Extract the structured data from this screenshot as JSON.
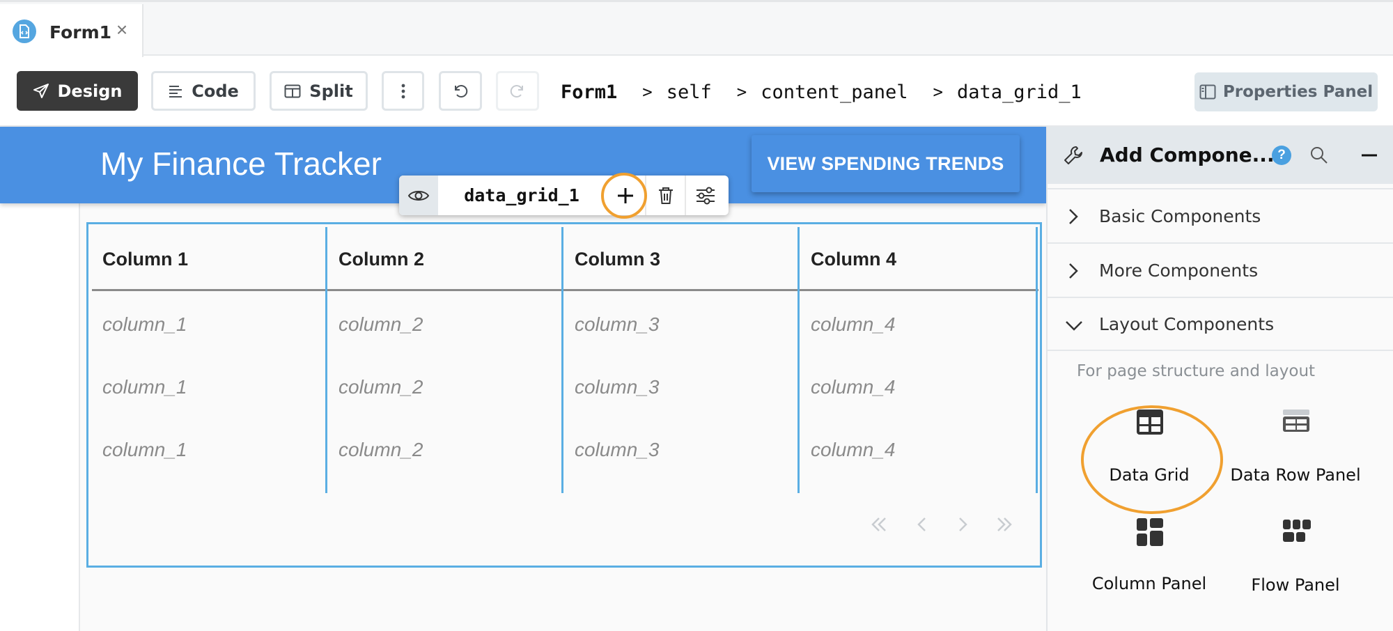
{
  "tab": {
    "label": "Form1",
    "icon": "form-file-icon",
    "close": "×"
  },
  "toolbar": {
    "design_label": "Design",
    "code_label": "Code",
    "split_label": "Split",
    "breadcrumb": [
      "Form1",
      "self",
      "content_panel",
      "data_grid_1"
    ],
    "breadcrumb_sep": ">",
    "properties_label": "Properties Panel"
  },
  "canvas": {
    "app_title": "My Finance Tracker",
    "trends_button": "VIEW SPENDING TRENDS",
    "component_toolbar": {
      "name": "data_grid_1"
    },
    "grid": {
      "columns": [
        "Column 1",
        "Column 2",
        "Column 3",
        "Column 4"
      ],
      "rows": [
        [
          "column_1",
          "column_2",
          "column_3",
          "column_4"
        ],
        [
          "column_1",
          "column_2",
          "column_3",
          "column_4"
        ],
        [
          "column_1",
          "column_2",
          "column_3",
          "column_4"
        ]
      ]
    }
  },
  "panel": {
    "title": "Add Compone...",
    "help": "?",
    "sections": [
      {
        "label": "Basic Components",
        "expanded": false
      },
      {
        "label": "More Components",
        "expanded": false
      },
      {
        "label": "Layout Components",
        "expanded": true
      }
    ],
    "description": "For page structure and layout",
    "components": [
      {
        "label": "Data Grid",
        "icon": "data-grid-icon"
      },
      {
        "label": "Data Row Panel",
        "icon": "data-row-panel-icon"
      },
      {
        "label": "Column Panel",
        "icon": "column-panel-icon"
      },
      {
        "label": "Flow Panel",
        "icon": "flow-panel-icon"
      }
    ]
  },
  "colors": {
    "accent": "#4a90e2",
    "highlight": "#f0a030",
    "grid_border": "#5aaee3"
  }
}
